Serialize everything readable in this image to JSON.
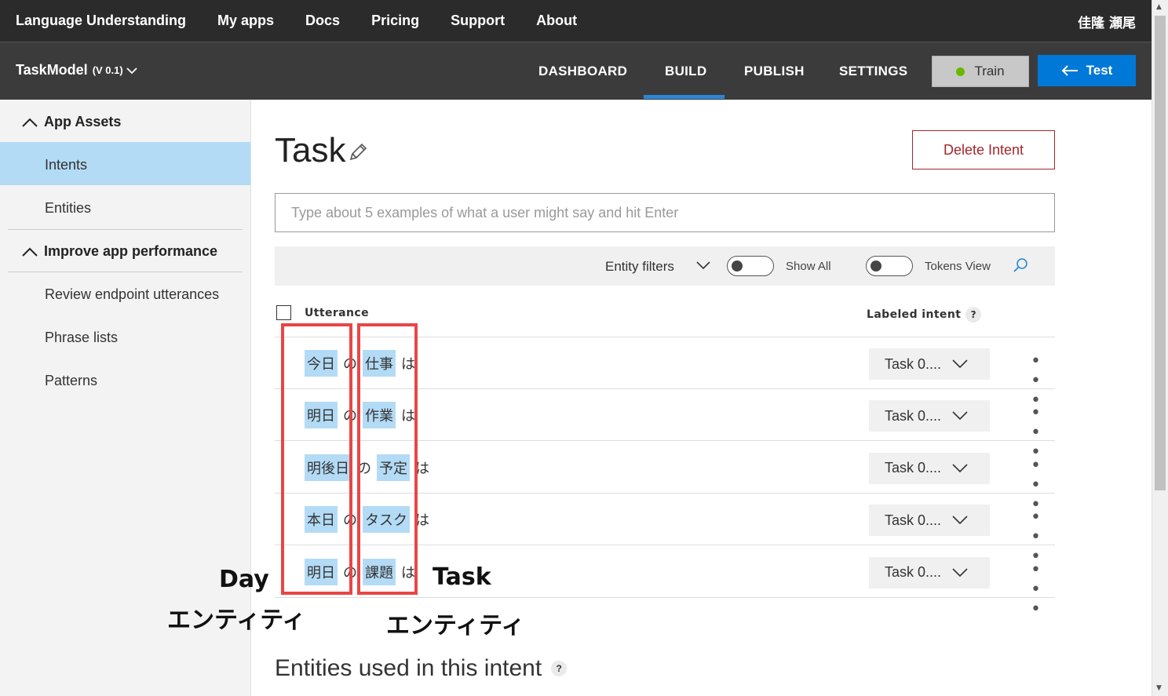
{
  "topnav": {
    "items": [
      "Language Understanding",
      "My apps",
      "Docs",
      "Pricing",
      "Support",
      "About"
    ],
    "user": "佳隆 瀬尾"
  },
  "subnav": {
    "app_name": "TaskModel",
    "app_version": "(V 0.1)",
    "tabs": [
      "DASHBOARD",
      "BUILD",
      "PUBLISH",
      "SETTINGS"
    ],
    "active_tab": "BUILD",
    "train_label": "Train",
    "test_label": "Test"
  },
  "sidebar": {
    "section1": "App Assets",
    "section1_items": [
      "Intents",
      "Entities"
    ],
    "section2": "Improve app performance",
    "section2_items": [
      "Review endpoint utterances",
      "Phrase lists",
      "Patterns"
    ],
    "active_item": "Intents"
  },
  "main": {
    "title": "Task",
    "delete_label": "Delete Intent",
    "input_placeholder": "Type about 5 examples of what a user might say and hit Enter",
    "filters": {
      "entity_filters": "Entity filters",
      "show_all": "Show All",
      "tokens_view": "Tokens View"
    },
    "table": {
      "col_utterance": "Utterance",
      "col_intent": "Labeled intent",
      "help": "?",
      "rows": [
        {
          "tokens": [
            {
              "t": "今日",
              "e": true
            },
            {
              "t": "の",
              "e": false
            },
            {
              "t": "仕事",
              "e": true
            },
            {
              "t": "は",
              "e": false
            }
          ],
          "intent": "Task 0...."
        },
        {
          "tokens": [
            {
              "t": "明日",
              "e": true
            },
            {
              "t": "の",
              "e": false
            },
            {
              "t": "作業",
              "e": true
            },
            {
              "t": "は",
              "e": false
            }
          ],
          "intent": "Task 0...."
        },
        {
          "tokens": [
            {
              "t": "明後日",
              "e": true
            },
            {
              "t": "の",
              "e": false
            },
            {
              "t": "予定",
              "e": true
            },
            {
              "t": "は",
              "e": false
            }
          ],
          "intent": "Task 0...."
        },
        {
          "tokens": [
            {
              "t": "本日",
              "e": true
            },
            {
              "t": "の",
              "e": false
            },
            {
              "t": "タスク",
              "e": true
            },
            {
              "t": "は",
              "e": false
            }
          ],
          "intent": "Task 0...."
        },
        {
          "tokens": [
            {
              "t": "明日",
              "e": true
            },
            {
              "t": "の",
              "e": false
            },
            {
              "t": "課題",
              "e": true
            },
            {
              "t": "は",
              "e": false
            }
          ],
          "intent": "Task 0...."
        }
      ],
      "more": "• • •"
    },
    "entities_title": "Entities used in this intent"
  },
  "annotations": {
    "day_en": "Day",
    "day_ja": "エンティティ",
    "task_en": "Task",
    "task_ja": "エンティティ"
  },
  "colors": {
    "accent": "#0078d7",
    "entity_highlight": "#b3dbf5",
    "callout": "#e84646",
    "delete": "#a4262c"
  }
}
